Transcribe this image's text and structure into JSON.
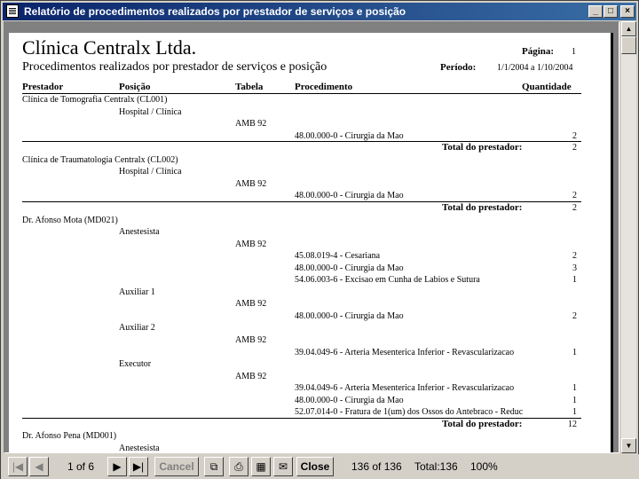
{
  "window": {
    "title": "Relatório de procedimentos realizados por prestador de serviços e posição",
    "minimize": "_",
    "maximize": "□",
    "close": "×"
  },
  "report": {
    "company": "Clínica Centralx Ltda.",
    "subtitle": "Procedimentos realizados por prestador de serviços e posição",
    "page_label": "Página:",
    "page_value": "1",
    "period_label": "Período:",
    "period_value": "1/1/2004  a  1/10/2004",
    "headers": {
      "prestador": "Prestador",
      "posicao": "Posição",
      "tabela": "Tabela",
      "procedimento": "Procedimento",
      "quantidade": "Quantidade"
    },
    "total_label": "Total do prestador:",
    "rows": [
      {
        "prestador": "Clínica de Tomografia Centralx (CL001)"
      },
      {
        "posicao": "Hospital / Clínica"
      },
      {
        "tabela": "AMB 92"
      },
      {
        "procedimento": "48.00.000-0 - Cirurgia da Mao",
        "quantidade": "2"
      },
      {
        "total": "2"
      },
      {
        "prestador": "Clínica de Traumatologia Centralx (CL002)"
      },
      {
        "posicao": "Hospital / Clínica"
      },
      {
        "tabela": "AMB 92"
      },
      {
        "procedimento": "48.00.000-0 - Cirurgia da Mao",
        "quantidade": "2"
      },
      {
        "total": "2"
      },
      {
        "prestador": "Dr. Afonso Mota (MD021)"
      },
      {
        "posicao": "Anestesista"
      },
      {
        "tabela": "AMB 92"
      },
      {
        "procedimento": "45.08.019-4 - Cesariana",
        "quantidade": "2"
      },
      {
        "procedimento": "48.00.000-0 - Cirurgia da Mao",
        "quantidade": "3"
      },
      {
        "procedimento": "54.06.003-6 - Excisao em Cunha de Labios e Sutura",
        "quantidade": "1"
      },
      {
        "posicao": "Auxiliar 1"
      },
      {
        "tabela": "AMB 92"
      },
      {
        "procedimento": "48.00.000-0 - Cirurgia da Mao",
        "quantidade": "2"
      },
      {
        "posicao": "Auxiliar 2"
      },
      {
        "tabela": "AMB 92"
      },
      {
        "procedimento": "39.04.049-6 - Arteria Mesenterica Inferior - Revascularizacao",
        "quantidade": "1"
      },
      {
        "posicao": "Executor"
      },
      {
        "tabela": "AMB 92"
      },
      {
        "procedimento": "39.04.049-6 - Arteria Mesenterica Inferior - Revascularizacao",
        "quantidade": "1"
      },
      {
        "procedimento": "48.00.000-0 - Cirurgia da Mao",
        "quantidade": "1"
      },
      {
        "procedimento": "52.07.014-0 - Fratura de 1(um) dos Ossos do Antebraco - Reduc",
        "quantidade": "1"
      },
      {
        "total": "12"
      },
      {
        "prestador": "Dr. Afonso Pena (MD001)"
      },
      {
        "posicao": "Anestesista"
      }
    ]
  },
  "statusbar": {
    "page_indicator": "1 of 6",
    "close_label": "Cancel",
    "close_button": "Close",
    "record_count": "136 of 136",
    "total": "Total:136",
    "zoom": "100%"
  }
}
